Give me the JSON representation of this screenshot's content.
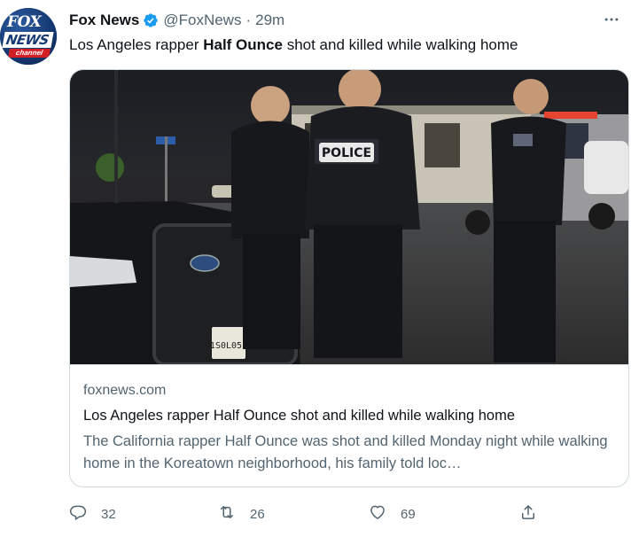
{
  "tweet": {
    "author_name": "Fox News",
    "handle": "@FoxNews",
    "separator": "·",
    "time": "29m",
    "text_before": "Los Angeles rapper ",
    "text_bold": "Half Ounce",
    "text_after": " shot and killed while walking home"
  },
  "avatar": {
    "logo_word_1": "FOX",
    "logo_word_2": "NEWS",
    "logo_word_3": "channel"
  },
  "card": {
    "domain": "foxnews.com",
    "title": "Los Angeles rapper Half Ounce shot and killed while walking home",
    "description": "The California rapper Half Ounce was shot and killed Monday night while walking home in the Koreatown neighborhood, his family told loc…",
    "image": {
      "vest_label": "POLICE",
      "plate_text": "1S0L051"
    }
  },
  "actions": {
    "reply_count": "32",
    "retweet_count": "26",
    "like_count": "69"
  },
  "icons": {
    "verified": "verified-badge-icon",
    "more": "more-dots-icon",
    "reply": "reply-icon",
    "retweet": "retweet-icon",
    "like": "heart-icon",
    "share": "share-icon"
  },
  "colors": {
    "verified": "#1d9bf0",
    "secondary_text": "#536471",
    "primary_text": "#0f1419",
    "border": "#cfd9de",
    "brand_blue": "#163a73",
    "brand_red": "#d11f26"
  }
}
